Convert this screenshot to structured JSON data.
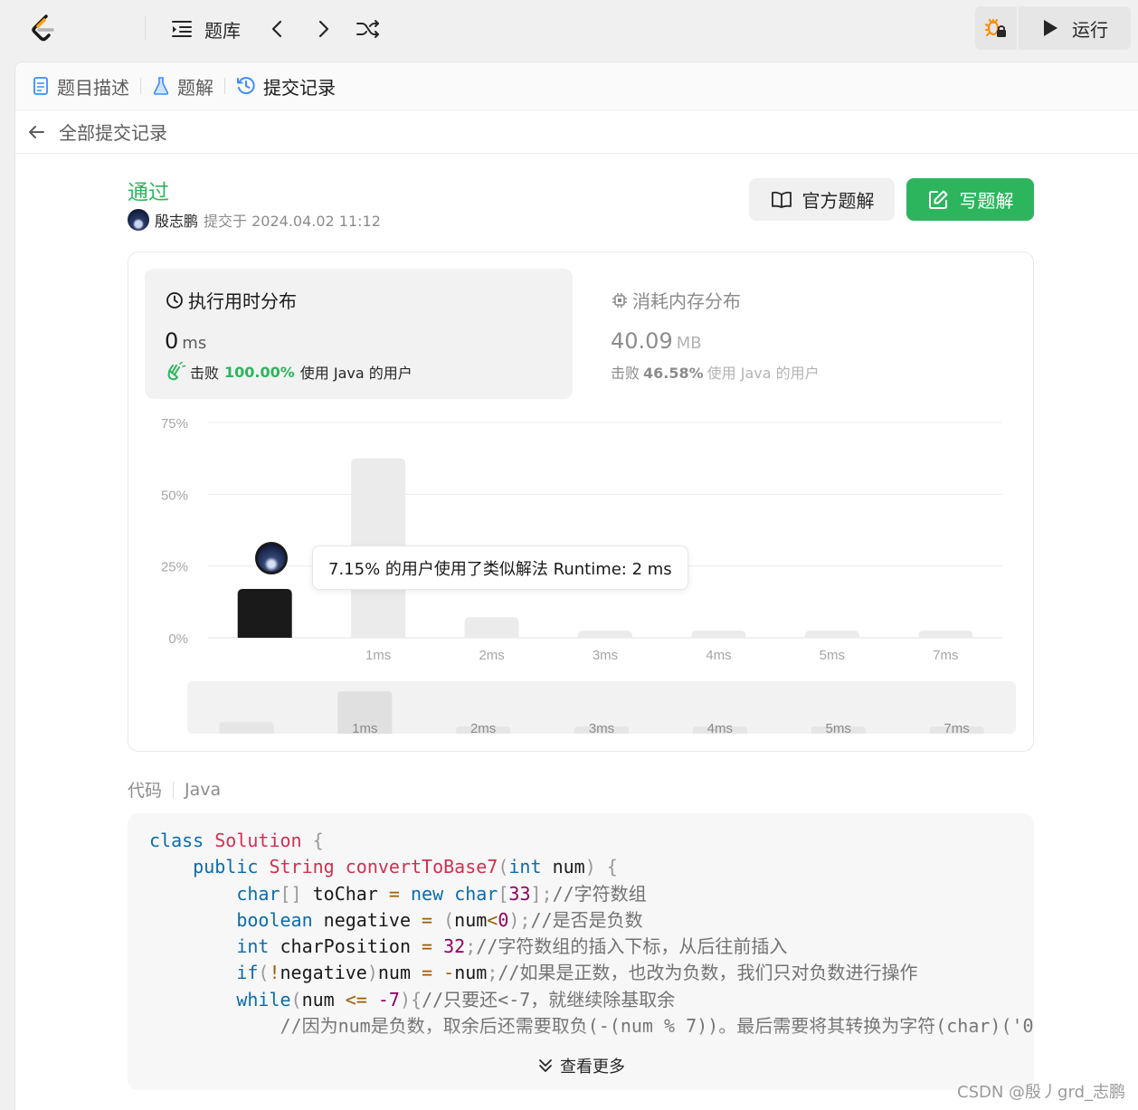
{
  "topbar": {
    "problem_bank_label": "题库",
    "run_label": "运行"
  },
  "tabs": [
    {
      "label": "题目描述"
    },
    {
      "label": "题解"
    },
    {
      "label": "提交记录"
    }
  ],
  "back": {
    "label": "全部提交记录"
  },
  "submission": {
    "status": "通过",
    "author": "殷志鹏",
    "submitted_at": "提交于 2024.04.02 11:12"
  },
  "buttons": {
    "official_solution": "官方题解",
    "write_solution": "写题解"
  },
  "runtime": {
    "title": "执行用时分布",
    "value": "0",
    "unit": "ms",
    "beat_prefix": "击败",
    "beat_percent": "100.00%",
    "beat_suffix": "使用 Java 的用户"
  },
  "memory": {
    "title": "消耗内存分布",
    "value": "40.09",
    "unit": "MB",
    "beat_prefix": "击败",
    "beat_percent": "46.58%",
    "beat_suffix": "使用 Java 的用户"
  },
  "tooltip": "7.15% 的用户使用了类似解法 Runtime: 2 ms",
  "chart_data": {
    "type": "bar",
    "categories": [
      "0ms",
      "1ms",
      "2ms",
      "3ms",
      "4ms",
      "5ms",
      "7ms"
    ],
    "tick_labels": [
      "",
      "1ms",
      "2ms",
      "3ms",
      "4ms",
      "5ms",
      "7ms"
    ],
    "values": [
      17,
      62.5,
      7.15,
      2.5,
      2.5,
      2.5,
      2.5
    ],
    "highlight_index": 0,
    "y_ticks": [
      "0%",
      "25%",
      "50%",
      "75%"
    ],
    "ylim": [
      0,
      75
    ],
    "grid": true,
    "colors": {
      "highlight": "#1a1a1a",
      "bar": "#ebebeb"
    }
  },
  "code_header": {
    "label": "代码",
    "language": "Java"
  },
  "code_lines": [
    [
      [
        "k",
        "class "
      ],
      [
        "t",
        "Solution"
      ],
      [
        "p",
        " {"
      ]
    ],
    [
      [
        "",
        "    "
      ],
      [
        "k",
        "public "
      ],
      [
        "t",
        "String "
      ],
      [
        "t",
        "convertToBase7"
      ],
      [
        "p",
        "("
      ],
      [
        "k",
        "int "
      ],
      [
        "",
        "num"
      ],
      [
        "p",
        ") {"
      ]
    ],
    [
      [
        "",
        "        "
      ],
      [
        "k",
        "char"
      ],
      [
        "p",
        "[] "
      ],
      [
        "",
        "toChar "
      ],
      [
        "o",
        "= "
      ],
      [
        "k",
        "new "
      ],
      [
        "k",
        "char"
      ],
      [
        "p",
        "["
      ],
      [
        "n",
        "33"
      ],
      [
        "p",
        "];"
      ],
      [
        "c",
        "//字符数组"
      ]
    ],
    [
      [
        "",
        "        "
      ],
      [
        "k",
        "boolean "
      ],
      [
        "",
        "negative "
      ],
      [
        "o",
        "= "
      ],
      [
        "p",
        "("
      ],
      [
        "",
        "num"
      ],
      [
        "o",
        "<"
      ],
      [
        "n",
        "0"
      ],
      [
        "p",
        ");"
      ],
      [
        "c",
        "//是否是负数"
      ]
    ],
    [
      [
        "",
        "        "
      ],
      [
        "k",
        "int "
      ],
      [
        "",
        "charPosition "
      ],
      [
        "o",
        "= "
      ],
      [
        "n",
        "32"
      ],
      [
        "p",
        ";"
      ],
      [
        "c",
        "//字符数组的插入下标，从后往前插入"
      ]
    ],
    [
      [
        "",
        "        "
      ],
      [
        "k",
        "if"
      ],
      [
        "p",
        "("
      ],
      [
        "o",
        "!"
      ],
      [
        "",
        "negative"
      ],
      [
        "p",
        ")"
      ],
      [
        "",
        "num "
      ],
      [
        "o",
        "= -"
      ],
      [
        "",
        "num"
      ],
      [
        "p",
        ";"
      ],
      [
        "c",
        "//如果是正数，也改为负数，我们只对负数进行操作"
      ]
    ],
    [
      [
        "",
        "        "
      ],
      [
        "k",
        "while"
      ],
      [
        "p",
        "("
      ],
      [
        "",
        "num "
      ],
      [
        "o",
        "<= "
      ],
      [
        "n",
        "-7"
      ],
      [
        "p",
        ")"
      ],
      [
        "p",
        "{"
      ],
      [
        "c",
        "//只要还<-7，就继续除基取余"
      ]
    ],
    [
      [
        "",
        "            "
      ],
      [
        "c",
        "//因为num是负数，取余后还需要取负(-(num % 7))。最后需要将其转换为字符(char)('0"
      ]
    ]
  ],
  "show_more": "查看更多",
  "watermark": "CSDN @殷丿grd_志鹏"
}
